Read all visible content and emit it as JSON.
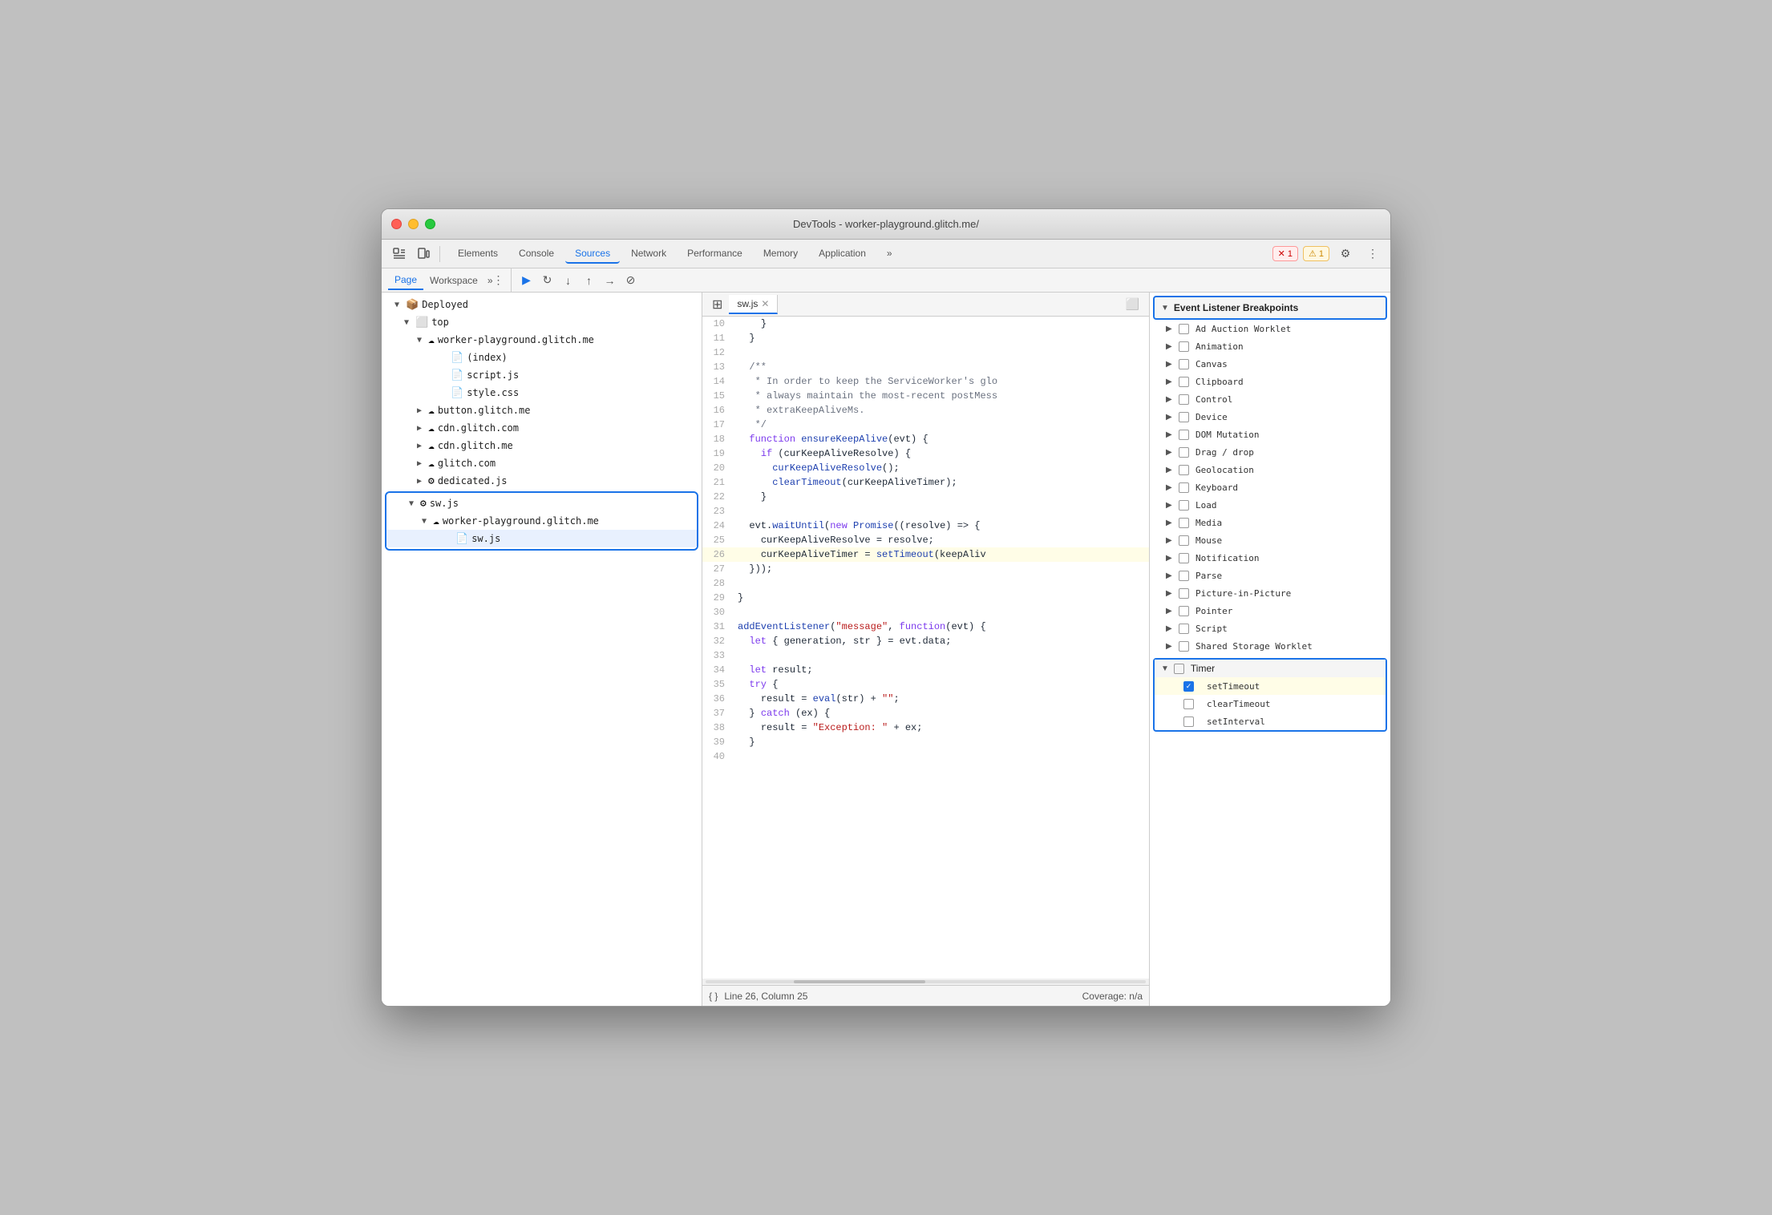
{
  "window": {
    "title": "DevTools - worker-playground.glitch.me/"
  },
  "toolbar": {
    "tabs": [
      "Elements",
      "Console",
      "Sources",
      "Network",
      "Performance",
      "Memory",
      "Application"
    ],
    "active_tab": "Sources",
    "more_label": "»",
    "error_count": "1",
    "warn_count": "1"
  },
  "left_panel": {
    "tabs": [
      "Page",
      "Workspace"
    ],
    "active_tab": "Page",
    "more_label": "»",
    "tree": [
      {
        "level": 0,
        "label": "Deployed",
        "type": "folder",
        "expanded": true,
        "icon": "deployed"
      },
      {
        "level": 1,
        "label": "top",
        "type": "folder",
        "expanded": true,
        "icon": "frame"
      },
      {
        "level": 2,
        "label": "worker-playground.glitch.me",
        "type": "folder",
        "expanded": true,
        "icon": "cloud"
      },
      {
        "level": 3,
        "label": "(index)",
        "type": "file",
        "icon": "page"
      },
      {
        "level": 3,
        "label": "script.js",
        "type": "file",
        "icon": "js"
      },
      {
        "level": 3,
        "label": "style.css",
        "type": "file",
        "icon": "css"
      },
      {
        "level": 2,
        "label": "button.glitch.me",
        "type": "folder",
        "icon": "cloud"
      },
      {
        "level": 2,
        "label": "cdn.glitch.com",
        "type": "folder",
        "icon": "cloud"
      },
      {
        "level": 2,
        "label": "cdn.glitch.me",
        "type": "folder",
        "icon": "cloud"
      },
      {
        "level": 2,
        "label": "glitch.com",
        "type": "folder",
        "icon": "cloud"
      },
      {
        "level": 2,
        "label": "dedicated.js",
        "type": "file",
        "icon": "gear-js"
      }
    ],
    "highlighted_group": {
      "items": [
        {
          "level": 1,
          "label": "sw.js",
          "type": "file",
          "icon": "gear-js",
          "expanded": true
        },
        {
          "level": 2,
          "label": "worker-playground.glitch.me",
          "type": "folder",
          "icon": "cloud",
          "expanded": true
        },
        {
          "level": 3,
          "label": "sw.js",
          "type": "file",
          "icon": "js-orange"
        }
      ]
    }
  },
  "code_panel": {
    "filename": "sw.js",
    "lines": [
      {
        "num": 10,
        "content": "    }"
      },
      {
        "num": 11,
        "content": "  }"
      },
      {
        "num": 12,
        "content": ""
      },
      {
        "num": 13,
        "content": "  /**"
      },
      {
        "num": 14,
        "content": "   * In order to keep the ServiceWorker's glo"
      },
      {
        "num": 15,
        "content": "   * always maintain the most-recent postMess"
      },
      {
        "num": 16,
        "content": "   * extraKeepAliveMs."
      },
      {
        "num": 17,
        "content": "   */"
      },
      {
        "num": 18,
        "content": "  function ensureKeepAlive(evt) {"
      },
      {
        "num": 19,
        "content": "    if (curKeepAliveResolve) {"
      },
      {
        "num": 20,
        "content": "      curKeepAliveResolve();"
      },
      {
        "num": 21,
        "content": "      clearTimeout(curKeepAliveTimer);"
      },
      {
        "num": 22,
        "content": "    }"
      },
      {
        "num": 23,
        "content": ""
      },
      {
        "num": 24,
        "content": "  evt.waitUntil(new Promise((resolve) => {"
      },
      {
        "num": 25,
        "content": "    curKeepAliveResolve = resolve;"
      },
      {
        "num": 26,
        "content": "    curKeepAliveTimer = setTimeout(keepAliv",
        "highlighted": true
      },
      {
        "num": 27,
        "content": "  }));"
      },
      {
        "num": 28,
        "content": ""
      },
      {
        "num": 29,
        "content": "}"
      },
      {
        "num": 30,
        "content": ""
      },
      {
        "num": 31,
        "content": "addEventListener(\"message\", function(evt) {"
      },
      {
        "num": 32,
        "content": "  let { generation, str } = evt.data;"
      },
      {
        "num": 33,
        "content": ""
      },
      {
        "num": 34,
        "content": "  let result;"
      },
      {
        "num": 35,
        "content": "  try {"
      },
      {
        "num": 36,
        "content": "    result = eval(str) + \"\";"
      },
      {
        "num": 37,
        "content": "  } catch (ex) {"
      },
      {
        "num": 38,
        "content": "    result = \"Exception: \" + ex;"
      },
      {
        "num": 39,
        "content": "  }"
      },
      {
        "num": 40,
        "content": ""
      }
    ],
    "status": {
      "format": "{ }",
      "position": "Line 26, Column 25",
      "coverage": "Coverage: n/a"
    }
  },
  "right_panel": {
    "section_title": "Event Listener Breakpoints",
    "items": [
      {
        "label": "Ad Auction Worklet",
        "checked": false,
        "expanded": false
      },
      {
        "label": "Animation",
        "checked": false,
        "expanded": false
      },
      {
        "label": "Canvas",
        "checked": false,
        "expanded": false
      },
      {
        "label": "Clipboard",
        "checked": false,
        "expanded": false
      },
      {
        "label": "Control",
        "checked": false,
        "expanded": false
      },
      {
        "label": "Device",
        "checked": false,
        "expanded": false
      },
      {
        "label": "DOM Mutation",
        "checked": false,
        "expanded": false
      },
      {
        "label": "Drag / drop",
        "checked": false,
        "expanded": false
      },
      {
        "label": "Geolocation",
        "checked": false,
        "expanded": false
      },
      {
        "label": "Keyboard",
        "checked": false,
        "expanded": false
      },
      {
        "label": "Load",
        "checked": false,
        "expanded": false
      },
      {
        "label": "Media",
        "checked": false,
        "expanded": false
      },
      {
        "label": "Mouse",
        "checked": false,
        "expanded": false
      },
      {
        "label": "Notification",
        "checked": false,
        "expanded": false
      },
      {
        "label": "Parse",
        "checked": false,
        "expanded": false
      },
      {
        "label": "Picture-in-Picture",
        "checked": false,
        "expanded": false
      },
      {
        "label": "Pointer",
        "checked": false,
        "expanded": false
      },
      {
        "label": "Script",
        "checked": false,
        "expanded": false
      },
      {
        "label": "Shared Storage Worklet",
        "checked": false,
        "expanded": false
      }
    ],
    "timer_section": {
      "label": "Timer",
      "expanded": true,
      "items": [
        {
          "label": "setTimeout",
          "checked": true,
          "active": true
        },
        {
          "label": "clearTimeout",
          "checked": false
        },
        {
          "label": "setInterval",
          "checked": false
        }
      ]
    }
  },
  "debug_toolbar": {
    "resume": "▶",
    "step_over": "↻",
    "step_into": "↓",
    "step_out": "↑",
    "step": "→",
    "deactivate": "⊘"
  }
}
